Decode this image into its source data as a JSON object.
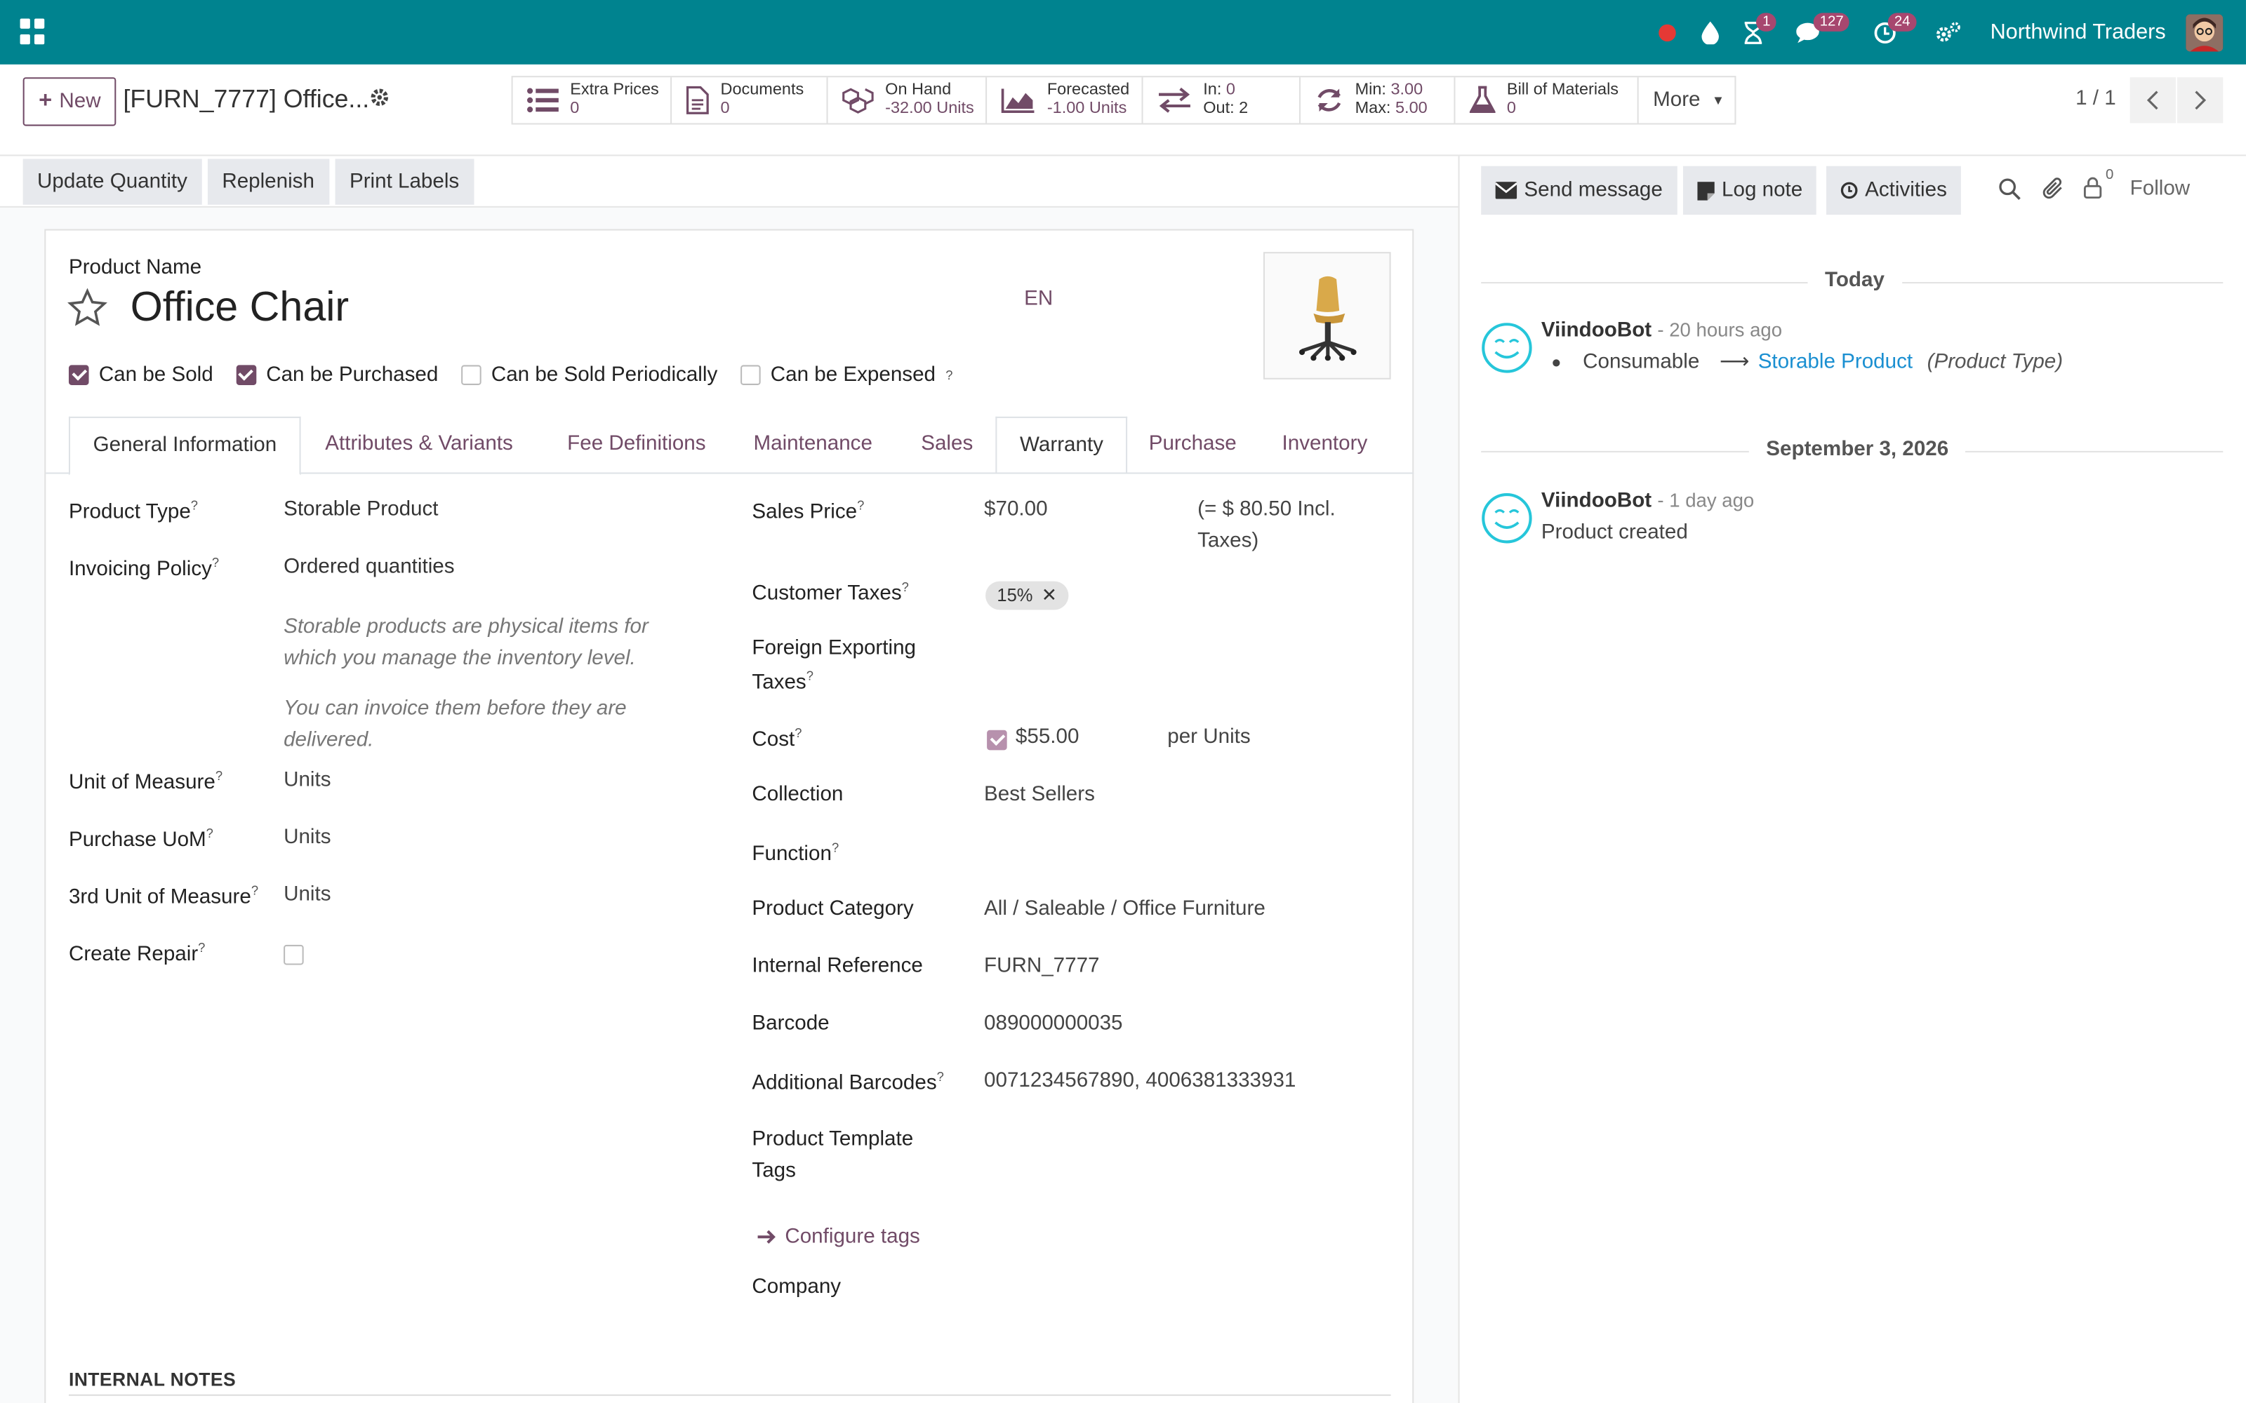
{
  "navbar": {
    "company": "Northwind Traders",
    "activity_badge": "1",
    "messages_badge": "127",
    "clock_badge": "24"
  },
  "control_panel": {
    "new_label": "New",
    "breadcrumb_title": "[FURN_7777] Office...",
    "pager": "1 / 1",
    "smart_buttons": [
      {
        "label": "Extra Prices",
        "value": "0"
      },
      {
        "label": "Documents",
        "value": "0"
      },
      {
        "label": "On Hand",
        "value": "-32.00 Units"
      },
      {
        "label": "Forecasted",
        "value": "-1.00 Units"
      },
      {
        "label_in": "In:",
        "in_value": "0",
        "label_out": "Out:",
        "out_value": "2"
      },
      {
        "label_min": "Min:",
        "min_value": "3.00",
        "label_max": "Max:",
        "max_value": "5.00"
      },
      {
        "label": "Bill of Materials",
        "value": "0"
      }
    ],
    "more_label": "More"
  },
  "actions": {
    "update_quantity": "Update Quantity",
    "replenish": "Replenish",
    "print_labels": "Print Labels"
  },
  "form": {
    "product_name_label": "Product Name",
    "product_name": "Office Chair",
    "lang": "EN",
    "checks": [
      {
        "label": "Can be Sold",
        "checked": true
      },
      {
        "label": "Can be Purchased",
        "checked": true
      },
      {
        "label": "Can be Sold Periodically",
        "checked": false
      },
      {
        "label": "Can be Expensed",
        "checked": false
      }
    ],
    "tabs": [
      "General Information",
      "Attributes & Variants",
      "Fee Definitions",
      "Maintenance",
      "Sales",
      "Warranty",
      "Purchase",
      "Inventory"
    ],
    "left": {
      "product_type_label": "Product Type",
      "product_type": "Storable Product",
      "invoicing_policy_label": "Invoicing Policy",
      "invoicing_policy": "Ordered quantities",
      "help_1": "Storable products are physical items for which you manage the inventory level.",
      "help_2": "You can invoice them before they are delivered.",
      "uom_label": "Unit of Measure",
      "uom": "Units",
      "purchase_uom_label": "Purchase UoM",
      "purchase_uom": "Units",
      "third_uom_label": "3rd Unit of Measure",
      "third_uom": "Units",
      "create_repair_label": "Create Repair"
    },
    "right": {
      "sales_price_label": "Sales Price",
      "sales_price": "$70.00",
      "incl_taxes_1": "(= $ 80.50 Incl.",
      "incl_taxes_2": "Taxes)",
      "customer_taxes_label": "Customer Taxes",
      "customer_tax_tag": "15%",
      "foreign_taxes_label_1": "Foreign Exporting",
      "foreign_taxes_label_2": "Taxes",
      "cost_label": "Cost",
      "cost": "$55.00",
      "cost_per": "per Units",
      "collection_label": "Collection",
      "collection": "Best Sellers",
      "function_label": "Function",
      "category_label": "Product Category",
      "category": "All / Saleable / Office Furniture",
      "internal_ref_label": "Internal Reference",
      "internal_ref": "FURN_7777",
      "barcode_label": "Barcode",
      "barcode": "089000000035",
      "add_barcodes_label": "Additional Barcodes",
      "add_barcodes": "0071234567890, 4006381333931",
      "tags_label_1": "Product Template",
      "tags_label_2": "Tags",
      "configure_tags": "Configure tags",
      "company_label": "Company"
    },
    "internal_notes": "INTERNAL NOTES"
  },
  "chatter": {
    "send_message": "Send message",
    "log_note": "Log note",
    "activities": "Activities",
    "followers_count": "0",
    "follow": "Follow",
    "groups": [
      {
        "date": "Today",
        "author": "ViindooBot",
        "when": "- 20 hours ago",
        "old_value": "Consumable",
        "new_value": "Storable Product",
        "field": "(Product Type)"
      },
      {
        "date": "September 3, 2026",
        "author": "ViindooBot",
        "when": "- 1 day ago",
        "body": "Product created"
      }
    ]
  },
  "colors": {
    "navbar": "#00838f",
    "brand": "#714b67",
    "link": "#1a8fd1"
  }
}
